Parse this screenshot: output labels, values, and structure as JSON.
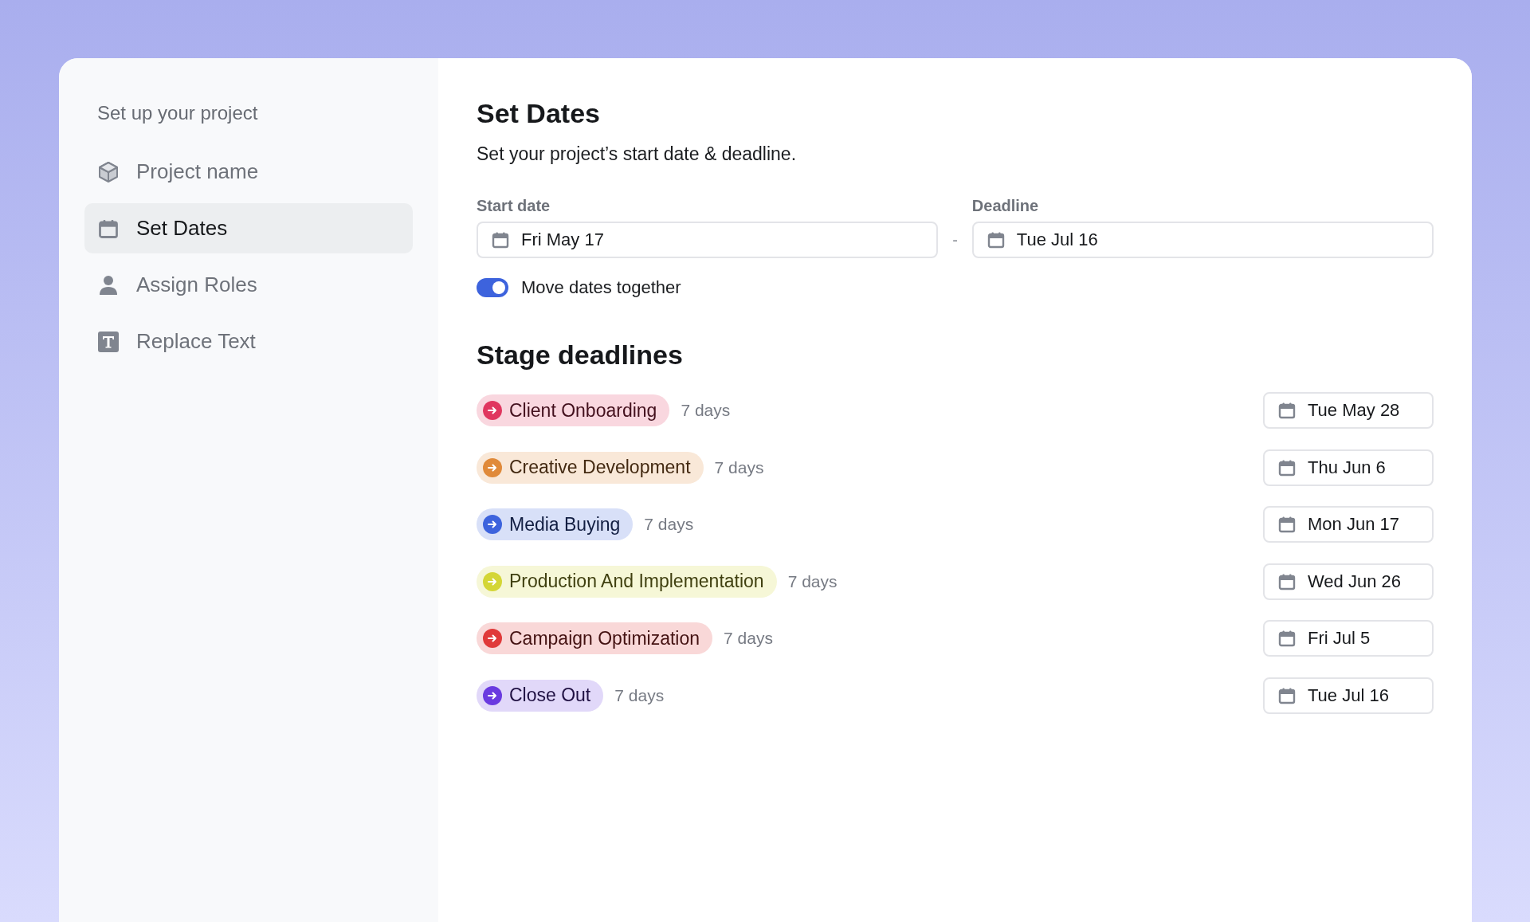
{
  "sidebar": {
    "title": "Set up your project",
    "items": [
      {
        "label": "Project name",
        "kind": "cube",
        "selected": false
      },
      {
        "label": "Set Dates",
        "kind": "calendar",
        "selected": true
      },
      {
        "label": "Assign Roles",
        "kind": "person",
        "selected": false
      },
      {
        "label": "Replace Text",
        "kind": "text",
        "selected": false
      }
    ]
  },
  "main": {
    "title": "Set Dates",
    "subtitle": "Set your project’s start date & deadline.",
    "start_date": {
      "label": "Start date",
      "value": "Fri May 17"
    },
    "separator": "-",
    "deadline": {
      "label": "Deadline",
      "value": "Tue Jul 16"
    },
    "move_together": {
      "label": "Move dates together",
      "on": true
    },
    "stages_title": "Stage deadlines",
    "stages": [
      {
        "name": "Client Onboarding",
        "color": "#e0365f",
        "duration": "7 days",
        "date": "Tue May 28"
      },
      {
        "name": "Creative Development",
        "color": "#e08a3a",
        "duration": "7 days",
        "date": "Thu Jun 6"
      },
      {
        "name": "Media Buying",
        "color": "#3d63dd",
        "duration": "7 days",
        "date": "Mon Jun 17"
      },
      {
        "name": "Production And Implementation",
        "color": "#d4d636",
        "duration": "7 days",
        "date": "Wed Jun 26"
      },
      {
        "name": "Campaign Optimization",
        "color": "#e03a3a",
        "duration": "7 days",
        "date": "Fri Jul 5"
      },
      {
        "name": "Close Out",
        "color": "#6a3ae0",
        "duration": "7 days",
        "date": "Tue Jul 16"
      }
    ]
  }
}
